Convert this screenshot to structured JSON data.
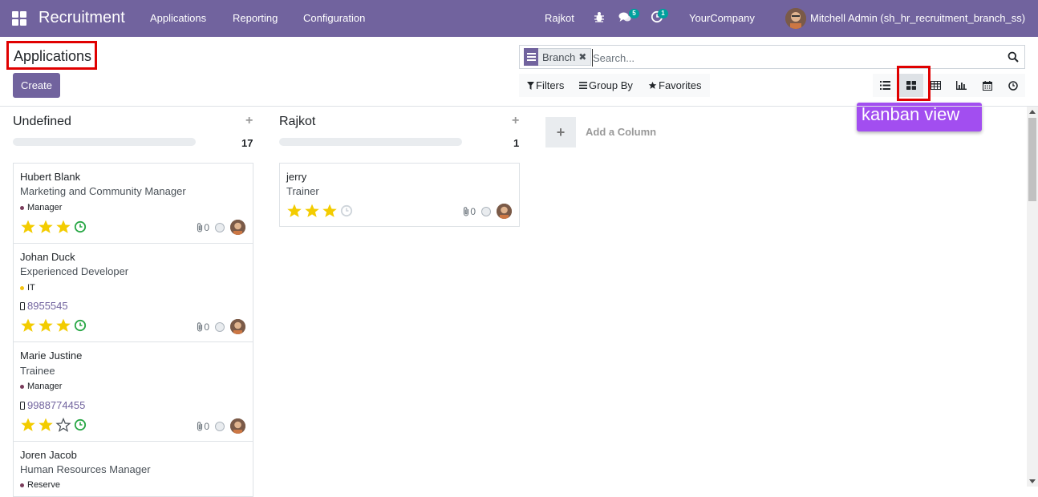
{
  "navbar": {
    "app_name": "Recruitment",
    "menu": [
      "Applications",
      "Reporting",
      "Configuration"
    ],
    "branch": "Rajkot",
    "messages_count": "5",
    "activities_count": "1",
    "company": "YourCompany",
    "user": "Mitchell Admin (sh_hr_recruitment_branch_ss)"
  },
  "control_panel": {
    "breadcrumb": "Applications",
    "create_label": "Create",
    "facet_label": "Branch",
    "facet_remove": "✖",
    "search_placeholder": "Search...",
    "filters_label": "Filters",
    "groupby_label": "Group By",
    "favorites_label": "Favorites",
    "kanban_tooltip": "kanban view"
  },
  "colors": {
    "brand": "#71639e",
    "annotation_red": "#e00000",
    "tooltip_purple": "#a24ef0",
    "star": "#f3cc00",
    "activity_green": "#28a745"
  },
  "columns": [
    {
      "title": "Undefined",
      "count": "17",
      "add": "+",
      "cards": [
        {
          "name": "Hubert Blank",
          "job": "Marketing and Community Manager",
          "tag": "Manager",
          "tag_color": "#7a3d5c",
          "phone": "",
          "stars": 3,
          "activity": "clock-green",
          "attachments": "0"
        },
        {
          "name": "Johan Duck",
          "job": "Experienced Developer",
          "tag": "IT",
          "tag_color": "#f4c311",
          "phone": "8955545",
          "stars": 3,
          "activity": "clock-green",
          "attachments": "0"
        },
        {
          "name": "Marie Justine",
          "job": "Trainee",
          "tag": "Manager",
          "tag_color": "#7a3d5c",
          "phone": "9988774455",
          "stars": 2,
          "activity": "clock-green",
          "attachments": "0"
        },
        {
          "name": "Joren Jacob",
          "job": "Human Resources Manager",
          "tag": "Reserve",
          "tag_color": "#7a3d5c",
          "phone": "",
          "stars": 0,
          "activity": "",
          "attachments": ""
        }
      ]
    },
    {
      "title": "Rajkot",
      "count": "1",
      "add": "+",
      "cards": [
        {
          "name": "jerry",
          "job": "Trainer",
          "tag": "",
          "tag_color": "",
          "phone": "",
          "stars": 3,
          "activity": "clock-grey",
          "attachments": "0"
        }
      ]
    }
  ],
  "add_column": {
    "icon": "+",
    "label": "Add a Column"
  }
}
